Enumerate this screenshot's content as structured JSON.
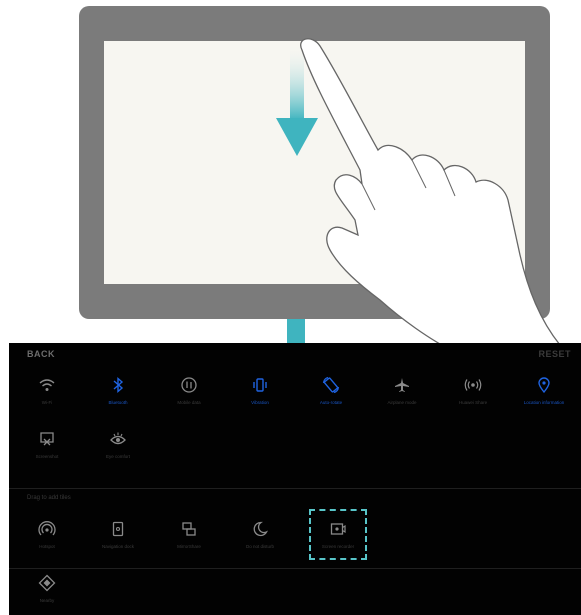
{
  "colors": {
    "tablet_frame": "#7b7b7b",
    "tablet_screen": "#f7f6f1",
    "arrow": "#3fb4bf",
    "panel_bg": "#020202",
    "active_icon": "#1f63e0",
    "inactive_icon": "#8a8a8a",
    "highlight_border": "#58c5c9"
  },
  "panel": {
    "back_label": "BACK",
    "reset_label": "RESET",
    "section_label": "Drag to add tiles",
    "active_tiles": [
      {
        "label": "Wi-Fi",
        "icon": "wifi-icon",
        "active": false
      },
      {
        "label": "Bluetooth",
        "icon": "bluetooth-icon",
        "active": true
      },
      {
        "label": "Mobile data",
        "icon": "mobile-data-icon",
        "active": false
      },
      {
        "label": "Vibration",
        "icon": "vibration-icon",
        "active": true
      },
      {
        "label": "Auto-rotate",
        "icon": "auto-rotate-icon",
        "active": true
      },
      {
        "label": "Airplane mode",
        "icon": "airplane-icon",
        "active": false
      },
      {
        "label": "Huawei Share",
        "icon": "huawei-share-icon",
        "active": false
      },
      {
        "label": "Location information",
        "icon": "location-icon",
        "active": true
      },
      {
        "label": "Screenshot",
        "icon": "screenshot-icon",
        "active": false
      },
      {
        "label": "Eye comfort",
        "icon": "eye-comfort-icon",
        "active": false
      }
    ],
    "available_tiles": [
      {
        "label": "Hotspot",
        "icon": "hotspot-icon"
      },
      {
        "label": "Navigation dock",
        "icon": "navigation-dock-icon"
      },
      {
        "label": "MirrorShare",
        "icon": "mirrorshare-icon"
      },
      {
        "label": "Do not disturb",
        "icon": "do-not-disturb-icon"
      },
      {
        "label": "Screen recorder",
        "icon": "screen-recorder-icon"
      },
      {
        "label": "Nearby",
        "icon": "nearby-icon"
      }
    ]
  }
}
